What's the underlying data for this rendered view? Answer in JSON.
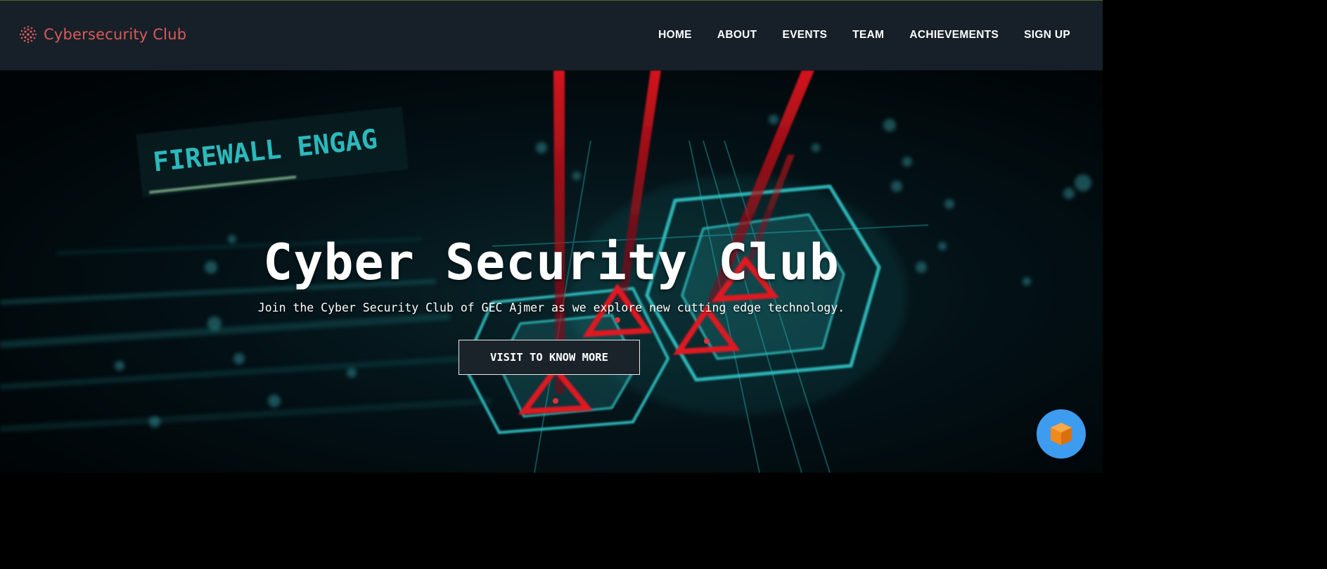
{
  "brand": {
    "name": "Cybersecurity Club",
    "logo_icon": "dotted-grid-logo-icon",
    "color": "#d95a5a"
  },
  "nav": {
    "items": [
      {
        "label": "HOME"
      },
      {
        "label": "ABOUT"
      },
      {
        "label": "EVENTS"
      },
      {
        "label": "TEAM"
      },
      {
        "label": "ACHIEVEMENTS"
      },
      {
        "label": "SIGN UP"
      }
    ],
    "background": "#172028"
  },
  "hero": {
    "title": "Cyber Security Club",
    "subtitle": "Join the Cyber Security Club of GEC Ajmer as we explore new cutting edge technology.",
    "cta_label": "VISIT TO KNOW MORE",
    "background_text": "FIREWALL ENGAG",
    "accent_cyan": "#2fe6e6",
    "accent_red": "#e3141e"
  },
  "chat_widget": {
    "icon": "cube-icon",
    "color": "#3d9cf0"
  }
}
